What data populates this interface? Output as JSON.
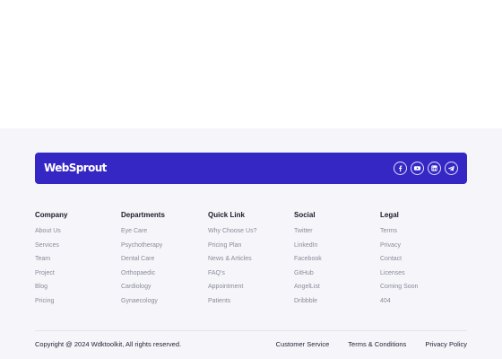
{
  "brand": {
    "logo_text": "WebSprout",
    "bar_color": "#3527c4",
    "social_icons": [
      "facebook-icon",
      "youtube-icon",
      "linkedin-icon",
      "telegram-icon"
    ]
  },
  "columns": [
    {
      "key": "company",
      "title": "Company",
      "items": [
        "About Us",
        "Services",
        "Team",
        "Project",
        "Blog",
        "Pricing"
      ]
    },
    {
      "key": "departments",
      "title": "Departments",
      "items": [
        "Eye Care",
        "Psychotherapy",
        "Dental Care",
        "Orthopaedic",
        "Cardiology",
        "Gynaecology"
      ]
    },
    {
      "key": "quick-link",
      "title": "Quick Link",
      "items": [
        "Why Choose Us?",
        "Pricing Plan",
        "News & Articles",
        "FAQ's",
        "Appointment",
        "Patients"
      ]
    },
    {
      "key": "social",
      "title": "Social",
      "items": [
        "Twitter",
        "LinkedIn",
        "Facebook",
        "GitHub",
        "AngelList",
        "Dribbble"
      ]
    },
    {
      "key": "legal",
      "title": "Legal",
      "items": [
        "Terms",
        "Privacy",
        "Contact",
        "Licenses",
        "Coming Soon",
        "404"
      ]
    }
  ],
  "bottom": {
    "copyright": "Copyright @ 2024 Wdktoolkit, All rights reserved.",
    "links": [
      "Customer Service",
      "Terms & Conditions",
      "Privacy Policy"
    ]
  }
}
